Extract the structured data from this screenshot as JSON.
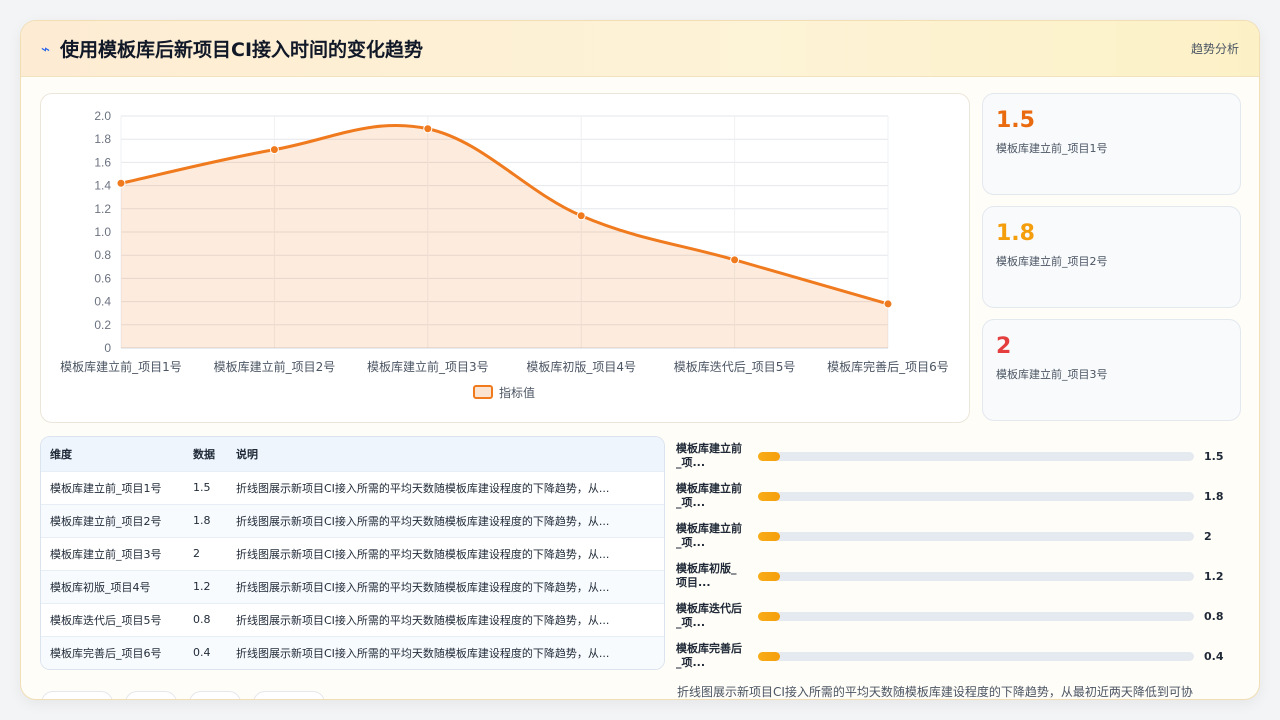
{
  "header": {
    "title": "使用模板库后新项目CI接入时间的变化趋势",
    "badge": "趋势分析"
  },
  "chart_data": {
    "type": "line",
    "area_fill": true,
    "smooth": true,
    "categories": [
      "模板库建立前_项目1号",
      "模板库建立前_项目2号",
      "模板库建立前_项目3号",
      "模板库初版_项目4号",
      "模板库迭代后_项目5号",
      "模板库完善后_项目6号"
    ],
    "series": [
      {
        "name": "指标值",
        "values": [
          1.42,
          1.71,
          1.89,
          1.14,
          0.76,
          0.38
        ],
        "color": "#f07a1e"
      }
    ],
    "ylim": [
      0,
      2.0
    ],
    "yticks": [
      "0",
      "0.2",
      "0.4",
      "0.6",
      "0.8",
      "1.0",
      "1.2",
      "1.4",
      "1.6",
      "1.8",
      "2.0"
    ],
    "grid": true,
    "legend": "bottom-center",
    "title": "",
    "xlabel": "",
    "ylabel": ""
  },
  "kpis": [
    {
      "value": "1.5",
      "label": "模板库建立前_项目1号",
      "color": "#ea6a10"
    },
    {
      "value": "1.8",
      "label": "模板库建立前_项目2号",
      "color": "#f59e0b"
    },
    {
      "value": "2",
      "label": "模板库建立前_项目3号",
      "color": "#e53e3e"
    }
  ],
  "table": {
    "headers": [
      "维度",
      "数据",
      "说明"
    ],
    "rows": [
      [
        "模板库建立前_项目1号",
        "1.5",
        "折线图展示新项目CI接入所需的平均天数随模板库建设程度的下降趋势，从..."
      ],
      [
        "模板库建立前_项目2号",
        "1.8",
        "折线图展示新项目CI接入所需的平均天数随模板库建设程度的下降趋势，从..."
      ],
      [
        "模板库建立前_项目3号",
        "2",
        "折线图展示新项目CI接入所需的平均天数随模板库建设程度的下降趋势，从..."
      ],
      [
        "模板库初版_项目4号",
        "1.2",
        "折线图展示新项目CI接入所需的平均天数随模板库建设程度的下降趋势，从..."
      ],
      [
        "模板库迭代后_项目5号",
        "0.8",
        "折线图展示新项目CI接入所需的平均天数随模板库建设程度的下降趋势，从..."
      ],
      [
        "模板库完善后_项目6号",
        "0.4",
        "折线图展示新项目CI接入所需的平均天数随模板库建设程度的下降趋势，从..."
      ]
    ]
  },
  "bars": [
    {
      "label": "模板库建立前\n_项...",
      "value": "1.5",
      "fill": 0.05
    },
    {
      "label": "模板库建立前\n_项...",
      "value": "1.8",
      "fill": 0.05
    },
    {
      "label": "模板库建立前\n_项...",
      "value": "2",
      "fill": 0.05
    },
    {
      "label": "模板库初版_\n项目...",
      "value": "1.2",
      "fill": 0.05
    },
    {
      "label": "模板库迭代后\n_项...",
      "value": "0.8",
      "fill": 0.05
    },
    {
      "label": "模板库完善后\n_项...",
      "value": "0.4",
      "fill": 0.05
    }
  ],
  "footnote": "折线图展示新项目CI接入所需的平均天数随模板库建设程度的下降趋势，从最初近两天降低到可协"
}
